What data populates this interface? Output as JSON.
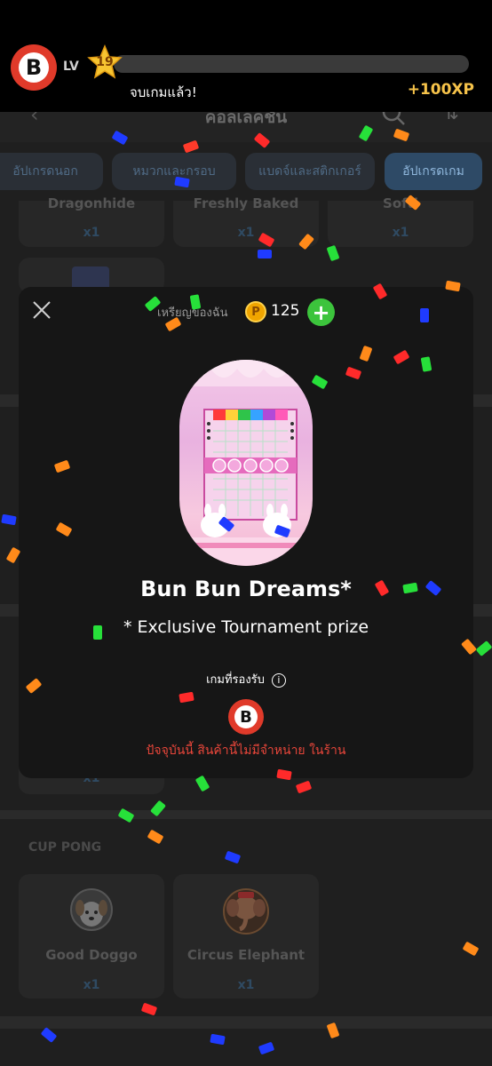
{
  "topbar": {
    "lv_label": "LV",
    "level": "19",
    "xp_progress": 0.0,
    "message": "จบเกมแล้ว!",
    "xp_gain": "+100XP",
    "app_logo_letter": "B"
  },
  "background": {
    "header_title": "คอลเลคชัน",
    "tabs": [
      "อัปเกรดนอก",
      "หมวกและกรอบ",
      "แบดจ์และสติกเกอร์",
      "อัปเกรดเกม"
    ],
    "active_tab": "อัปเกรดเกม",
    "row1": [
      {
        "name": "Dragonhide",
        "qty": "x1"
      },
      {
        "name": "Freshly Baked",
        "qty": "x1"
      },
      {
        "name": "Softi",
        "qty": "x1"
      }
    ],
    "row_partial_qty": "x1",
    "section_cup_pong": "CUP PONG",
    "cup_pong_items": [
      {
        "name": "Good Doggo",
        "qty": "x1",
        "icon": "dog-icon"
      },
      {
        "name": "Circus Elephant",
        "qty": "x1",
        "icon": "elephant-icon"
      }
    ]
  },
  "modal": {
    "coins_label": "เหรียญของฉัน",
    "coin_symbol": "P",
    "coin_count": "125",
    "plus_label": "+",
    "prize_title": "Bun Bun Dreams*",
    "prize_subtitle": "* Exclusive Tournament prize",
    "supported_games_label": "เกมที่รองรับ",
    "game_logo_letter": "B",
    "unavailable_text": "ปัจจุบันนี้ สินค้านี้ไม่มีจำหน่าย ในร้าน"
  },
  "colors": {
    "accent_gold": "#f6c34a",
    "warning_red": "#e8463a",
    "plus_green": "#3cc43c",
    "logo_red": "#e03a2a"
  }
}
